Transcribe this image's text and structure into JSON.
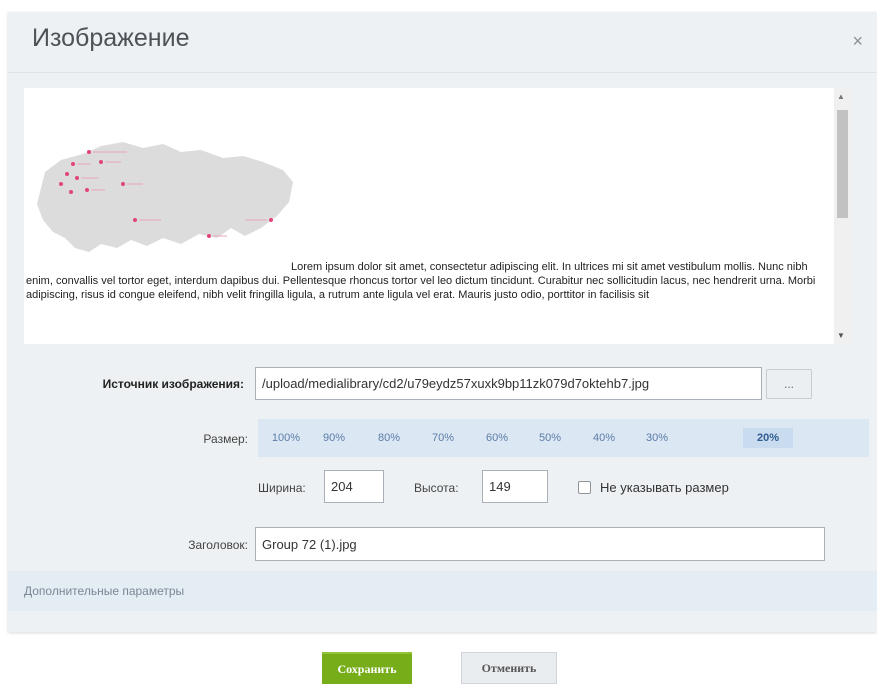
{
  "dialog": {
    "title": "Изображение",
    "close_glyph": "×"
  },
  "preview": {
    "text": "Lorem ipsum dolor sit amet, consectetur adipiscing elit. In ultrices mi sit amet vestibulum mollis. Nunc nibh enim, convallis vel tortor eget, interdum dapibus dui. Pellentesque rhoncus tortor vel leo dictum tincidunt. Curabitur nec sollicitudin lacus, nec hendrerit urna. Morbi adipiscing, risus id congue eleifend, nibh velit fringilla ligula, a rutrum ante ligula vel erat. Mauris justo odio, porttitor in facilisis sit",
    "image_icon": "russia-map-image"
  },
  "source": {
    "label": "Источник изображения:",
    "value": "/upload/medialibrary/cd2/u79eydz57xuxk9bp11zk079d7oktehb7.jpg",
    "browse_label": "..."
  },
  "size": {
    "label": "Размер:",
    "options": [
      "100%",
      "90%",
      "80%",
      "70%",
      "60%",
      "50%",
      "40%",
      "30%",
      "20%"
    ],
    "selected": "20%"
  },
  "dimensions": {
    "width_label": "Ширина:",
    "width_value": "204",
    "height_label": "Высота:",
    "height_value": "149",
    "no_size_label": "Не указывать размер",
    "no_size_checked": false
  },
  "caption": {
    "label": "Заголовок:",
    "value": "Group 72 (1).jpg"
  },
  "extra": {
    "label": "Дополнительные параметры"
  },
  "buttons": {
    "save": "Сохранить",
    "cancel": "Отменить"
  },
  "colors": {
    "save_green": "#76ad19",
    "size_row_blue": "#dbe7f3",
    "map_fill": "#dcdcdc",
    "map_markers": "#e0457b"
  }
}
